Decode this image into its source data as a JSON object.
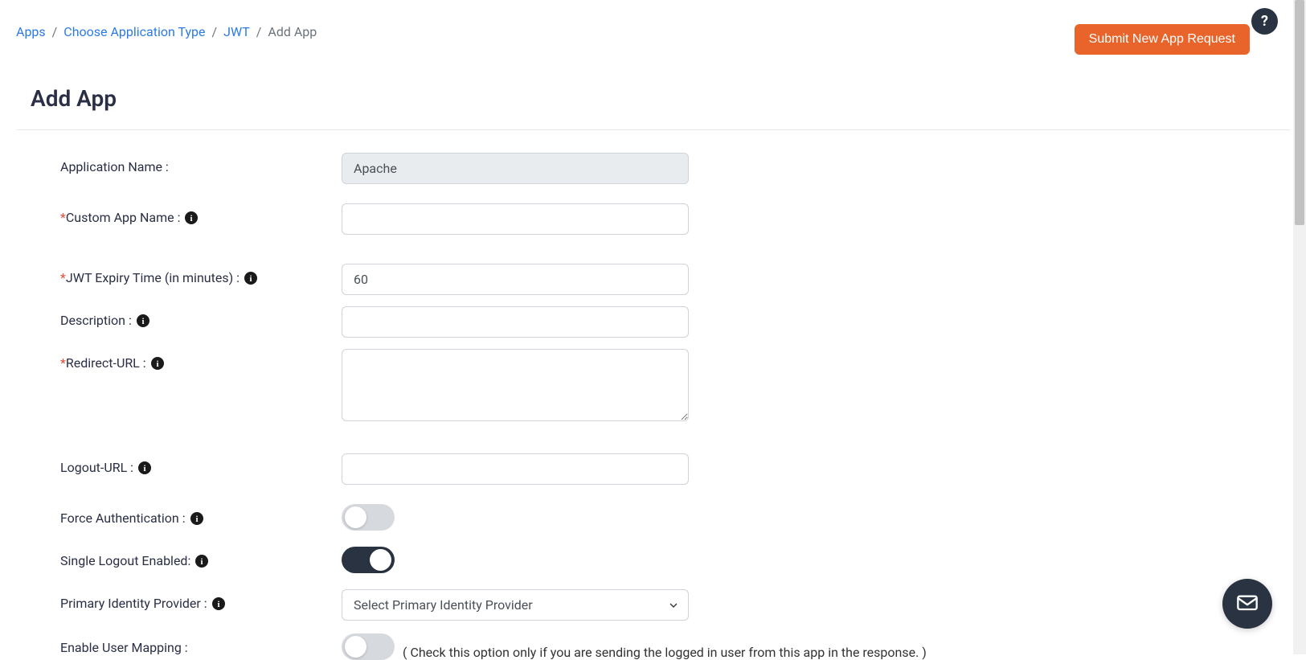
{
  "breadcrumb": {
    "items": [
      {
        "label": "Apps",
        "link": true
      },
      {
        "label": "Choose Application Type",
        "link": true
      },
      {
        "label": "JWT",
        "link": true
      },
      {
        "label": "Add App",
        "link": false
      }
    ],
    "sep": "/"
  },
  "header": {
    "submit_button": "Submit New App Request",
    "page_title": "Add App",
    "help_label": "?"
  },
  "form": {
    "applicationName": {
      "label": "Application Name :",
      "value": "Apache",
      "required": false
    },
    "customAppName": {
      "label": "Custom App Name :",
      "value": "",
      "required": true,
      "info": true
    },
    "jwtExpiry": {
      "label": "JWT Expiry Time (in minutes) :",
      "value": "60",
      "required": true,
      "info": true
    },
    "description": {
      "label": "Description :",
      "value": "",
      "required": false,
      "info": true
    },
    "redirectUrl": {
      "label": "Redirect-URL :",
      "value": "",
      "required": true,
      "info": true
    },
    "logoutUrl": {
      "label": "Logout-URL :",
      "value": "",
      "required": false,
      "info": true
    },
    "forceAuth": {
      "label": "Force Authentication :",
      "on": false,
      "info": true
    },
    "singleLogout": {
      "label": "Single Logout Enabled:",
      "on": true,
      "info": true
    },
    "primaryIdp": {
      "label": "Primary Identity Provider :",
      "selected": "Select Primary Identity Provider",
      "info": true
    },
    "enableUserMapping": {
      "label": "Enable User Mapping :",
      "on": false,
      "hint": "( Check this option only if you are sending the logged in user from this app in the response. )"
    }
  }
}
